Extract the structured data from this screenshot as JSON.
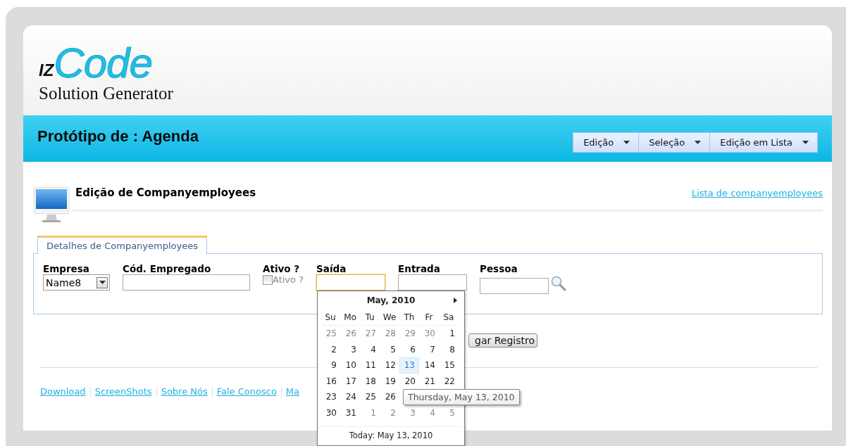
{
  "logo": {
    "prefix": "IZ",
    "name": "Code",
    "tagline": "Solution Generator"
  },
  "title": "Protótipo de : Agenda",
  "menus": [
    {
      "label": "Edição"
    },
    {
      "label": "Seleção"
    },
    {
      "label": "Edição em Lista"
    }
  ],
  "section": {
    "title": "Edição de Companyemployees",
    "link": "Lista de companyemployees"
  },
  "tabs": [
    {
      "label": "Detalhes de Companyemployees",
      "selected": true
    }
  ],
  "fields": [
    {
      "kind": "select",
      "label": "Empresa",
      "value": "Name8"
    },
    {
      "kind": "text",
      "label": "Cód. Empregado"
    },
    {
      "kind": "checkbox",
      "label": "Ativo ?",
      "option": "Ativo ?",
      "checked": false
    },
    {
      "kind": "date",
      "label": "Saída",
      "focused": true
    },
    {
      "kind": "date",
      "label": "Entrada",
      "focused": false
    },
    {
      "kind": "lookup",
      "label": "Pessoa"
    }
  ],
  "button": {
    "label": "gar Registro"
  },
  "footer_links": [
    "Download",
    "ScreenShots",
    "Sobre Nós",
    "Fale Conosco",
    "Ma"
  ],
  "calendar": {
    "month": "May, 2010",
    "weekdays": [
      "Su",
      "Mo",
      "Tu",
      "We",
      "Th",
      "Fr",
      "Sa"
    ],
    "weeks": [
      [
        {
          "day": "25",
          "muted": true,
          "selected": false
        },
        {
          "day": "26",
          "muted": true,
          "selected": false
        },
        {
          "day": "27",
          "muted": true,
          "selected": false
        },
        {
          "day": "28",
          "muted": true,
          "selected": false
        },
        {
          "day": "29",
          "muted": true,
          "selected": false
        },
        {
          "day": "30",
          "muted": true,
          "selected": false
        },
        {
          "day": "1",
          "muted": false,
          "selected": false
        }
      ],
      [
        {
          "day": "2",
          "muted": false,
          "selected": false
        },
        {
          "day": "3",
          "muted": false,
          "selected": false
        },
        {
          "day": "4",
          "muted": false,
          "selected": false
        },
        {
          "day": "5",
          "muted": false,
          "selected": false
        },
        {
          "day": "6",
          "muted": false,
          "selected": false
        },
        {
          "day": "7",
          "muted": false,
          "selected": false
        },
        {
          "day": "8",
          "muted": false,
          "selected": false
        }
      ],
      [
        {
          "day": "9",
          "muted": false,
          "selected": false
        },
        {
          "day": "10",
          "muted": false,
          "selected": false
        },
        {
          "day": "11",
          "muted": false,
          "selected": false
        },
        {
          "day": "12",
          "muted": false,
          "selected": false
        },
        {
          "day": "13",
          "muted": false,
          "selected": true
        },
        {
          "day": "14",
          "muted": false,
          "selected": false
        },
        {
          "day": "15",
          "muted": false,
          "selected": false
        }
      ],
      [
        {
          "day": "16",
          "muted": false,
          "selected": false
        },
        {
          "day": "17",
          "muted": false,
          "selected": false
        },
        {
          "day": "18",
          "muted": false,
          "selected": false
        },
        {
          "day": "19",
          "muted": false,
          "selected": false
        },
        {
          "day": "20",
          "muted": false,
          "selected": false
        },
        {
          "day": "21",
          "muted": false,
          "selected": false
        },
        {
          "day": "22",
          "muted": false,
          "selected": false
        }
      ],
      [
        {
          "day": "23",
          "muted": false,
          "selected": false
        },
        {
          "day": "24",
          "muted": false,
          "selected": false
        },
        {
          "day": "25",
          "muted": false,
          "selected": false
        },
        {
          "day": "26",
          "muted": false,
          "selected": false
        }
      ],
      [
        {
          "day": "30",
          "muted": false,
          "selected": false
        },
        {
          "day": "31",
          "muted": false,
          "selected": false
        },
        {
          "day": "1",
          "muted": true,
          "selected": false
        },
        {
          "day": "2",
          "muted": true,
          "selected": false
        },
        {
          "day": "3",
          "muted": true,
          "selected": false
        },
        {
          "day": "4",
          "muted": true,
          "selected": false
        },
        {
          "day": "5",
          "muted": true,
          "selected": false
        }
      ]
    ],
    "today": "Today: May 13, 2010"
  },
  "tooltip": "Thursday, May 13, 2010"
}
